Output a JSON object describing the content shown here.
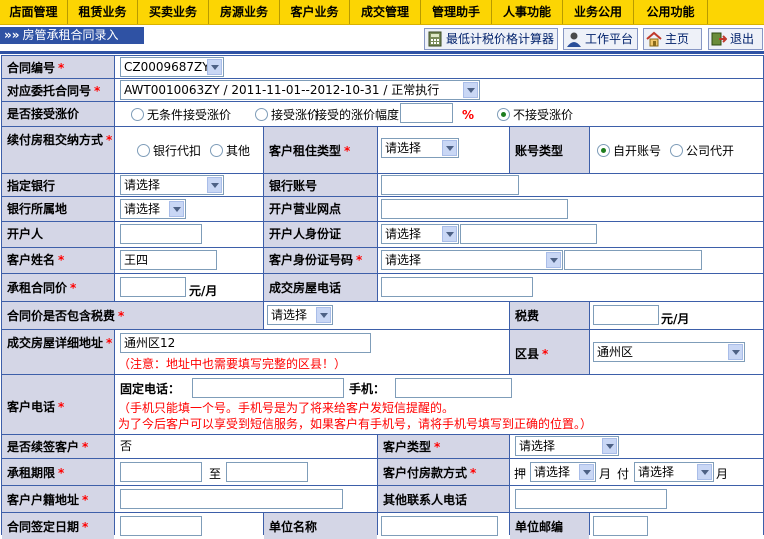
{
  "nav": {
    "items": [
      "店面管理",
      "租赁业务",
      "买卖业务",
      "房源业务",
      "客户业务",
      "成交管理",
      "管理助手",
      "人事功能",
      "业务公用",
      "公用功能"
    ]
  },
  "header": {
    "arrow": "»»",
    "title": "房管承租合同录入",
    "calc_label": "最低计税价格计算器",
    "workbench_label": "工作平台",
    "home_label": "主页",
    "exit_label": "退出"
  },
  "required_mark": "*",
  "form": {
    "contract_no": {
      "label": "合同编号",
      "value": "CZ0009687ZY"
    },
    "entrust_contract": {
      "label": "对应委托合同号",
      "value": "AWT0010063ZY / 2011-11-01--2012-10-31 / 正常执行"
    },
    "rent_increase": {
      "label": "是否接受涨价",
      "opt_unconditional": "无条件接受涨价",
      "opt_accept": "接受涨价",
      "range_label": "接受的涨价幅度",
      "percent": "%",
      "opt_reject": "不接受涨价",
      "selected": "不接受涨价"
    },
    "renew_pay": {
      "label": "续付房租交纳方式",
      "opt_bank": "银行代扣",
      "opt_other": "其他",
      "tenant_type_label": "客户租住类型",
      "tenant_type_value": "请选择",
      "account_type_label": "账号类型",
      "opt_self": "自开账号",
      "opt_company": "公司代开",
      "account_selected": "自开账号"
    },
    "bank": {
      "label": "指定银行",
      "value": "请选择",
      "account_label": "银行账号",
      "account_value": ""
    },
    "bank_location": {
      "label": "银行所属地",
      "value": "请选择",
      "branch_label": "开户营业网点",
      "branch_value": ""
    },
    "account_holder": {
      "label": "开户人",
      "value": "",
      "id_label": "开户人身份证",
      "id_type": "请选择",
      "id_value": ""
    },
    "customer_name": {
      "label": "客户姓名",
      "value": "王四",
      "id_label": "客户身份证号码",
      "id_type": "请选择",
      "id_value": ""
    },
    "rent_price": {
      "label": "承租合同价",
      "value": "",
      "unit": "元/月",
      "phone_label": "成交房屋电话",
      "phone_value": ""
    },
    "tax_included": {
      "label": "合同价是否包含税费",
      "value": "请选择",
      "tax_label": "税费",
      "tax_value": "",
      "unit": "元/月"
    },
    "address": {
      "label": "成交房屋详细地址",
      "value": "通州区12",
      "note": "（注意：地址中也需要填写完整的区县！）",
      "district_label": "区县",
      "district_value": "通州区"
    },
    "customer_phone": {
      "label": "客户电话",
      "landline_label": "固定电话：",
      "landline_value": "",
      "mobile_label": "手机：",
      "mobile_value": "",
      "note1": "（手机只能填一个号。手机号是为了将来给客户发短信提醒的。",
      "note2": "为了今后客户可以享受到短信服务，如果客户有手机号，请将手机号填写到正确的位置。）"
    },
    "renewal": {
      "label": "是否续签客户",
      "value": "否",
      "type_label": "客户类型",
      "type_value": "请选择"
    },
    "term": {
      "label": "承租期限",
      "from": "",
      "to_label": "至",
      "to": "",
      "pay_label": "客户付房款方式",
      "ya_label": "押",
      "ya_value": "请选择",
      "month1": "月",
      "fu_label": "付",
      "fu_value": "请选择",
      "month2": "月"
    },
    "hukou": {
      "label": "客户户籍地址",
      "value": "",
      "other_label": "其他联系人电话",
      "other_value": ""
    },
    "sign_date": {
      "label": "合同签定日期",
      "value": "",
      "unit_label": "单位名称",
      "unit_value": "",
      "zip_label": "单位邮编",
      "zip_value": ""
    }
  }
}
